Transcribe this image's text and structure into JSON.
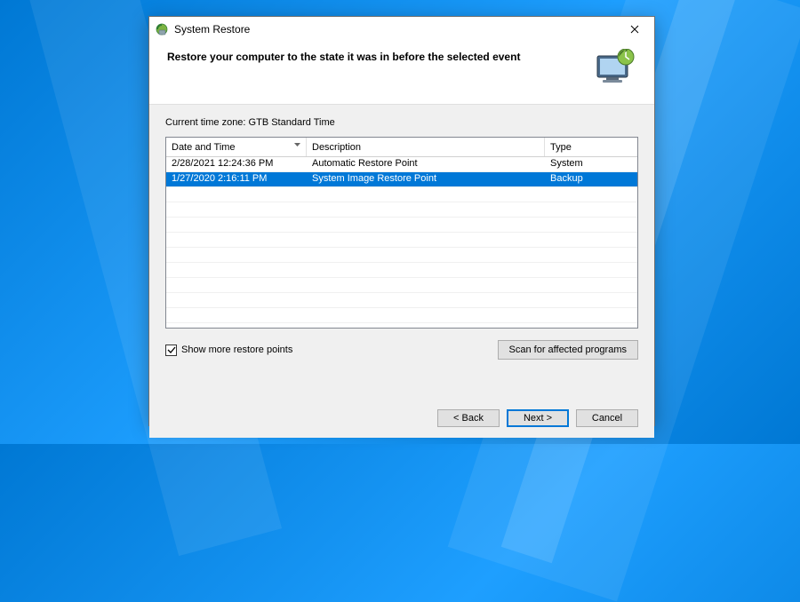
{
  "window": {
    "title": "System Restore",
    "heading": "Restore your computer to the state it was in before the selected event"
  },
  "timezone": {
    "label": "Current time zone: GTB Standard Time"
  },
  "columns": {
    "date": "Date and Time",
    "description": "Description",
    "type": "Type"
  },
  "rows": [
    {
      "date": "2/28/2021 12:24:36 PM",
      "description": "Automatic Restore Point",
      "type": "System",
      "selected": false
    },
    {
      "date": "1/27/2020 2:16:11 PM",
      "description": "System Image Restore Point",
      "type": "Backup",
      "selected": true
    }
  ],
  "checkbox": {
    "show_more_label": "Show more restore points",
    "checked": true
  },
  "buttons": {
    "scan": "Scan for affected programs",
    "back": "< Back",
    "next": "Next >",
    "cancel": "Cancel"
  }
}
